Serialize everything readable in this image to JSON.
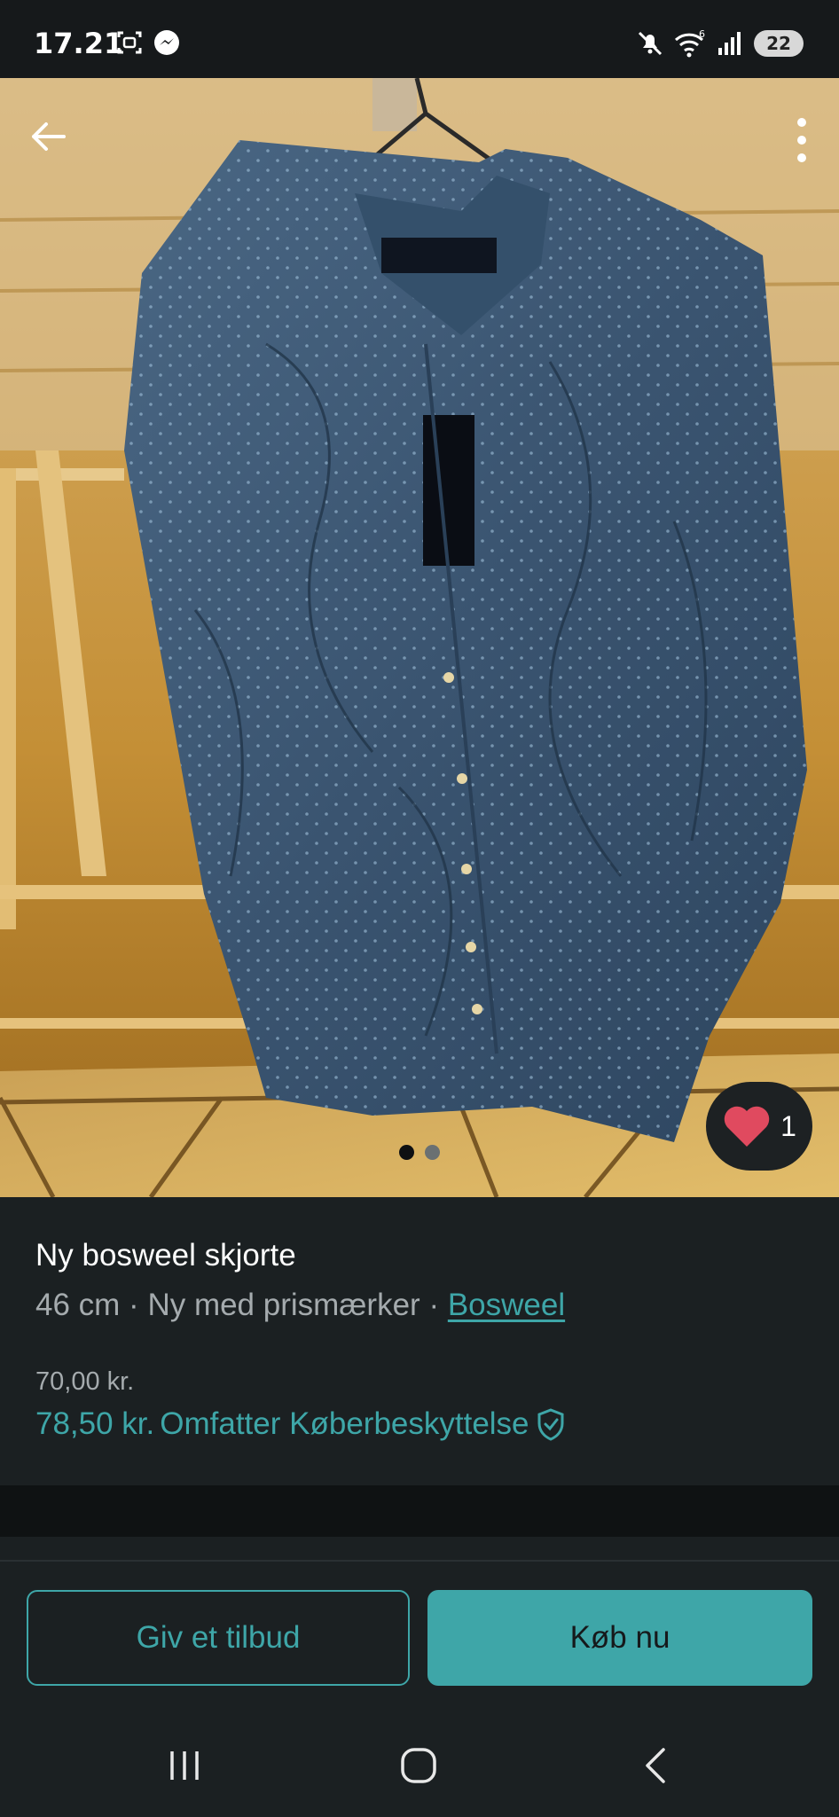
{
  "status_bar": {
    "time": "17.21",
    "battery": "22",
    "icons": [
      "screenshot-icon",
      "messenger-icon",
      "mute-icon",
      "wifi-icon",
      "signal-icon"
    ]
  },
  "photo": {
    "icons": {
      "back": "arrow-left-icon",
      "more": "more-vertical-icon",
      "favorite": "heart-icon"
    },
    "favorite_count": "1",
    "pagination": {
      "total": 2,
      "active": 1
    }
  },
  "item": {
    "title": "Ny bosweel skjorte",
    "size": "46 cm",
    "separator": "·",
    "condition": "Ny med prismærker",
    "brand": "Bosweel",
    "price": "70,00 kr.",
    "price_with_protection": "78,50 kr.",
    "protection_label": "Omfatter Køberbeskyttelse",
    "protection_icon": "shield-check-icon"
  },
  "actions": {
    "offer_label": "Giv et tilbud",
    "buy_label": "Køb nu"
  },
  "system_nav": {
    "icons": [
      "recent-apps-icon",
      "home-icon",
      "back-icon"
    ]
  },
  "colors": {
    "background": "#16191b",
    "panel": "#1b2022",
    "accent": "#3ea6a8",
    "muted_text": "#a5abae",
    "heart": "#e04a5f"
  }
}
